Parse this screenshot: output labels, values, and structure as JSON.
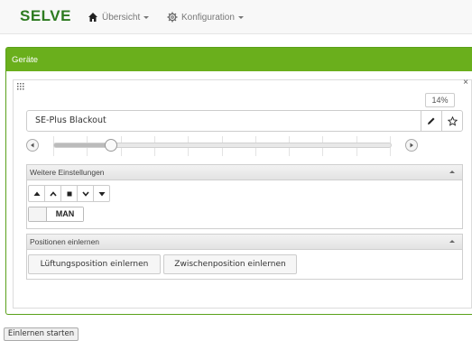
{
  "navbar": {
    "brand": "SELVE",
    "menu": [
      {
        "label": "Übersicht",
        "icon": "home-icon"
      },
      {
        "label": "Konfiguration",
        "icon": "gear-icon"
      }
    ]
  },
  "panel": {
    "title": "Geräte"
  },
  "device": {
    "name": "SE-Plus Blackout",
    "position_percent": "14%",
    "position_value": 14,
    "slider_level": 0.17,
    "close": "×"
  },
  "settings": {
    "title": "Weitere Einstellungen",
    "controls": [
      "up-limit",
      "up",
      "stop",
      "down",
      "down-limit"
    ],
    "mode_label": "MAN"
  },
  "learn": {
    "title": "Positionen einlernen",
    "buttons": [
      "Lüftungsposition einlernen",
      "Zwischenposition einlernen"
    ]
  },
  "footer": {
    "start_label": "Einlernen starten"
  },
  "colors": {
    "brand": "#2d7a20",
    "panel_header": "#6aaf1c"
  }
}
